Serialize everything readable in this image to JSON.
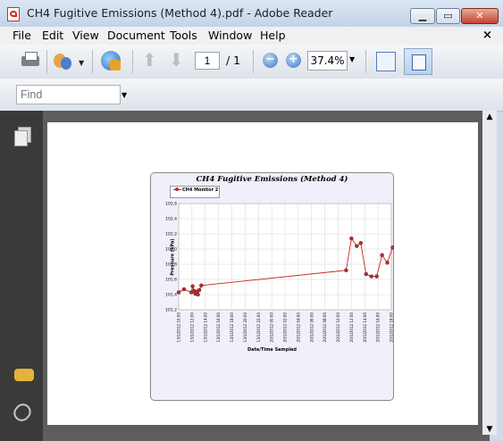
{
  "window": {
    "title": "CH4 Fugitive Emissions (Method 4).pdf - Adobe Reader",
    "min_label": "▁",
    "max_label": "▭",
    "close_label": "✕"
  },
  "menu": [
    "File",
    "Edit",
    "View",
    "Document",
    "Tools",
    "Window",
    "Help"
  ],
  "menu_close": "×",
  "toolbar": {
    "page_current": "1",
    "page_total": "/ 1",
    "zoom": "37.4%",
    "zoom_out": "−",
    "zoom_in": "+"
  },
  "find": {
    "placeholder": "Find"
  },
  "chart_data": {
    "type": "line",
    "title": "CH4 Fugitive Emissions (Method 4)",
    "xlabel": "Date/Time Sampled",
    "ylabel": "Pressure (kPa)",
    "ylim": [
      101.2,
      102.6
    ],
    "yticks": [
      "102.6",
      "102.4",
      "102.2",
      "102.0",
      "101.8",
      "101.6",
      "101.4",
      "101.2"
    ],
    "xticks": [
      "13/1/2012 10:00",
      "13/1/2012 12:00",
      "13/1/2012 14:00",
      "13/1/2012 16:00",
      "13/1/2012 18:00",
      "13/1/2012 20:00",
      "13/1/2012 22:00",
      "20/1/2012 00:00",
      "20/1/2012 02:00",
      "20/1/2012 04:00",
      "20/1/2012 06:00",
      "20/1/2012 08:00",
      "20/1/2012 10:00",
      "20/1/2012 12:00",
      "20/1/2012 14:00",
      "20/1/2012 16:00",
      "20/1/2012 18:00"
    ],
    "legend_placement": "top-left",
    "grid": true,
    "series": [
      {
        "name": "CH4 Monitor 2",
        "color": "#cc2222",
        "x": [
          0.0,
          0.4,
          0.95,
          1.05,
          1.15,
          1.25,
          1.35,
          1.45,
          1.55,
          1.7,
          12.6,
          13.0,
          13.4,
          13.7,
          14.1,
          14.5,
          14.9,
          15.3,
          15.7,
          16.1
        ],
        "values": [
          101.43,
          101.47,
          101.43,
          101.51,
          101.45,
          101.41,
          101.44,
          101.4,
          101.46,
          101.52,
          101.72,
          102.14,
          102.04,
          102.08,
          101.67,
          101.64,
          101.64,
          101.92,
          101.82,
          102.02
        ]
      }
    ]
  }
}
